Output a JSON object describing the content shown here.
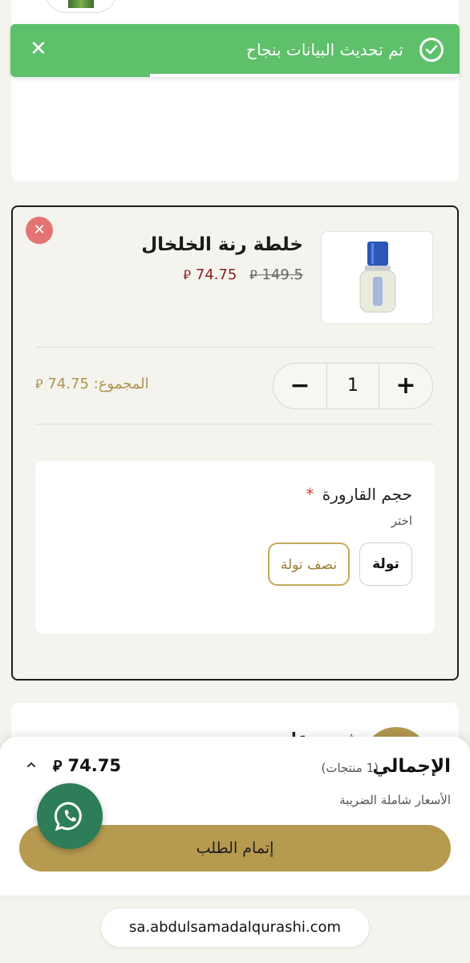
{
  "toast": {
    "message": "تم تحديث البيانات بنجاح",
    "progress": 0.69
  },
  "cart_item": {
    "name": "خلطة رنة الخلخال",
    "old_price": "149.5",
    "new_price": "74.75",
    "currency_symbol": "⃁",
    "quantity": "1",
    "subtotal_label": "المجموع:",
    "subtotal_value": "74.75"
  },
  "option": {
    "title": "حجم القارورة",
    "required_mark": "*",
    "hint": "اختر",
    "choices": [
      "تولة",
      "نصف تولة"
    ],
    "selected": "نصف تولة"
  },
  "next_item_peek": "شرو وعات",
  "summary": {
    "total_label": "الإجمالي",
    "count_label": "(1 منتجات)",
    "total_amount": "74.75",
    "tax_note": "الأسعار شاملة الضريبة",
    "checkout_label": "إتمام الطلب"
  },
  "browser": {
    "url": "sa.abdulsamadalqurashi.com"
  },
  "colors": {
    "toast_green": "#5ec06a",
    "gold": "#b69a4f",
    "sale_red": "#8b2020",
    "whatsapp_green": "#2d7d58"
  },
  "icons": [
    "check-circle-icon",
    "close-icon",
    "remove-icon",
    "minus-icon",
    "plus-icon",
    "chevron-up-icon",
    "whatsapp-icon",
    "riyal-currency-icon"
  ]
}
